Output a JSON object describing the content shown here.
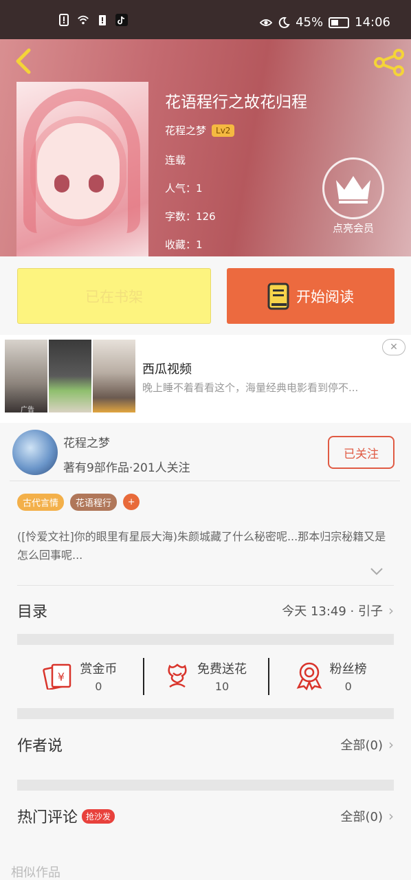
{
  "status_bar": {
    "battery": "45%",
    "time": "14:06"
  },
  "book": {
    "title": "花语程行之故花归程",
    "author": "花程之梦",
    "level": "Lv2",
    "status": "连载",
    "popularity": "人气：1",
    "word_count": "字数：126",
    "favorites": "收藏：1",
    "vip_label": "点亮会员"
  },
  "actions": {
    "shelf_label": "已在书架",
    "read_label": "开始阅读"
  },
  "ad": {
    "app_name": "西瓜视频",
    "description": "晚上睡不着看看这个，海量经典电影看到停不...",
    "ad_label": "广告"
  },
  "author": {
    "name": "花程之梦",
    "info": "著有9部作品·201人关注",
    "follow_label": "已关注"
  },
  "tags": [
    "古代言情",
    "花语程行"
  ],
  "synopsis": "([怜爱文社]你的眼里有星辰大海)朱颜城藏了什么秘密呢...那本归宗秘籍又是怎么回事呢...",
  "catalog": {
    "title": "目录",
    "latest": "今天 13:49 · 引子"
  },
  "stats": [
    {
      "label": "赏金币",
      "value": "0"
    },
    {
      "label": "免费送花",
      "value": "10"
    },
    {
      "label": "粉丝榜",
      "value": "0"
    }
  ],
  "author_says": {
    "title": "作者说",
    "all": "全部(0)"
  },
  "comments": {
    "title": "热门评论",
    "badge": "抢沙发",
    "all": "全部(0)"
  },
  "similar": {
    "title": "相似作品"
  }
}
